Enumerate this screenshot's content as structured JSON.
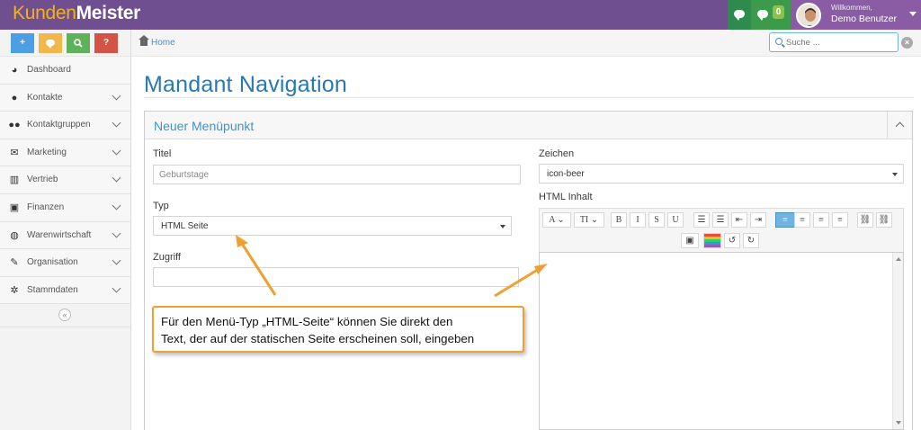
{
  "app": {
    "logo_part1": "Kunden",
    "logo_part2": "Meister",
    "notification_count": "0",
    "welcome": "Willkommen,",
    "user_name": "Demo Benutzer"
  },
  "shortcuts": [
    "+",
    "",
    "",
    "?"
  ],
  "sidebar": {
    "items": [
      {
        "label": "Dashboard",
        "icon": "dashboard-icon",
        "glyph": "◕",
        "chevron": false
      },
      {
        "label": "Kontakte",
        "icon": "user-icon",
        "glyph": "●",
        "chevron": true
      },
      {
        "label": "Kontaktgruppen",
        "icon": "users-icon",
        "glyph": "●●",
        "chevron": true
      },
      {
        "label": "Marketing",
        "icon": "envelope-icon",
        "glyph": "✉",
        "chevron": true
      },
      {
        "label": "Vertrieb",
        "icon": "bar-chart-icon",
        "glyph": "▥",
        "chevron": true
      },
      {
        "label": "Finanzen",
        "icon": "money-icon",
        "glyph": "▣",
        "chevron": true
      },
      {
        "label": "Warenwirtschaft",
        "icon": "globe-icon",
        "glyph": "◍",
        "chevron": true
      },
      {
        "label": "Organisation",
        "icon": "edit-icon",
        "glyph": "✎",
        "chevron": true
      },
      {
        "label": "Stammdaten",
        "icon": "cogs-icon",
        "glyph": "✲",
        "chevron": true
      }
    ],
    "collapse_glyph": "«"
  },
  "breadcrumb": {
    "home": "Home"
  },
  "search": {
    "placeholder": "Suche ..."
  },
  "page": {
    "title": "Mandant Navigation"
  },
  "panel": {
    "title": "Neuer Menüpunkt"
  },
  "form": {
    "titel_label": "Titel",
    "titel_value": "Geburtstage",
    "typ_label": "Typ",
    "typ_value": "HTML Seite",
    "zugriff_label": "Zugriff",
    "zugriff_value": "",
    "zeichen_label": "Zeichen",
    "zeichen_value": "icon-beer",
    "html_label": "HTML Inhalt"
  },
  "editor_toolbar": [
    {
      "name": "font-color-button",
      "glyph": "A ⌄"
    },
    {
      "name": "font-size-button",
      "glyph": "TI ⌄"
    },
    {
      "name": "bold-button",
      "glyph": "B"
    },
    {
      "name": "italic-button",
      "glyph": "I"
    },
    {
      "name": "strikethrough-button",
      "glyph": "S"
    },
    {
      "name": "underline-button",
      "glyph": "U"
    },
    {
      "name": "bullet-list-button",
      "glyph": "☰"
    },
    {
      "name": "numbered-list-button",
      "glyph": "☰"
    },
    {
      "name": "outdent-button",
      "glyph": "⇤"
    },
    {
      "name": "indent-button",
      "glyph": "⇥"
    },
    {
      "name": "align-left-button",
      "glyph": "≡"
    },
    {
      "name": "align-center-button",
      "glyph": "≡"
    },
    {
      "name": "align-right-button",
      "glyph": "≡"
    },
    {
      "name": "justify-button",
      "glyph": "≡"
    },
    {
      "name": "link-button",
      "glyph": "⛓"
    },
    {
      "name": "unlink-button",
      "glyph": "⛓"
    },
    {
      "name": "image-button",
      "glyph": "▣"
    },
    {
      "name": "background-color-button",
      "glyph": "▤"
    },
    {
      "name": "undo-button",
      "glyph": "↺"
    },
    {
      "name": "redo-button",
      "glyph": "↻"
    }
  ],
  "callout": {
    "line1": "Für den Menü-Typ „HTML-Seite“ können Sie direkt den",
    "line2": "Text, der auf der statischen Seite erscheinen soll, eingeben"
  },
  "colors": {
    "topbar": "#6f4f8f",
    "accent": "#4c8fbd",
    "callout_border": "#f0a030"
  }
}
